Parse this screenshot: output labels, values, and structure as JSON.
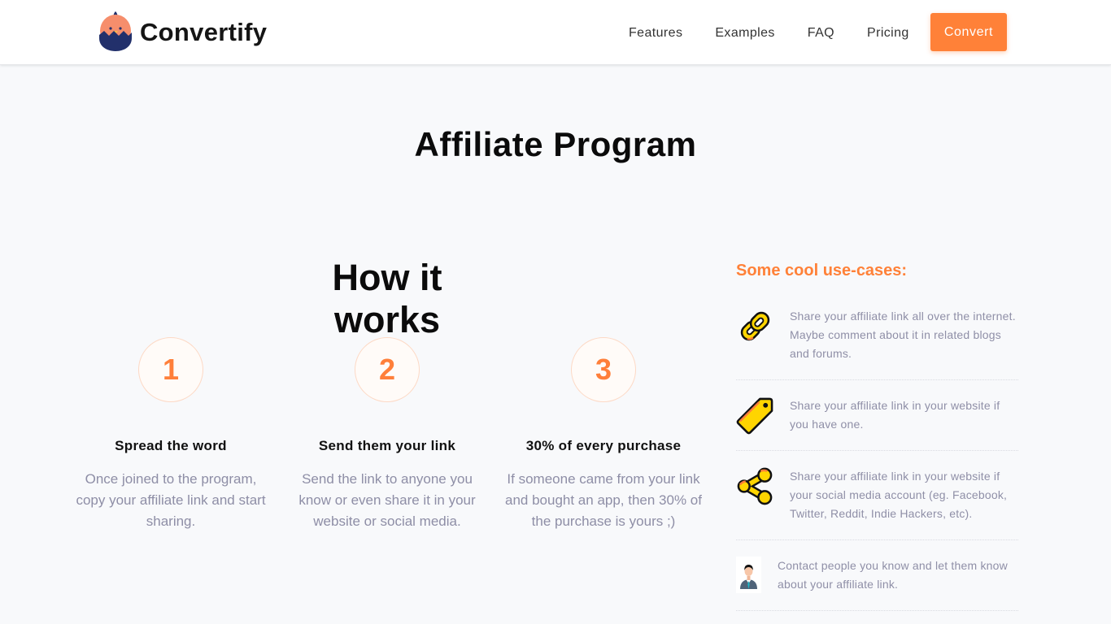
{
  "header": {
    "brand": "Convertify",
    "nav": [
      "Features",
      "Examples",
      "FAQ",
      "Pricing"
    ],
    "cta_label": "Convert"
  },
  "page": {
    "title": "Affiliate Program"
  },
  "how_it_works": {
    "title": "How it works",
    "steps": [
      {
        "number": "1",
        "title": "Spread the word",
        "description": "Once joined to the program, copy your affiliate link and start sharing."
      },
      {
        "number": "2",
        "title": "Send them your link",
        "description": "Send the link to anyone you know or even share it in your website or social media."
      },
      {
        "number": "3",
        "title": "30% of every purchase",
        "description": "If someone came from your link and bought an app, then 30% of the purchase is yours ;)"
      }
    ]
  },
  "use_cases": {
    "title": "Some cool use-cases:",
    "items": [
      {
        "icon": "chain-link-icon",
        "text": "Share your affiliate link all over the internet. Maybe comment about it in related blogs and forums."
      },
      {
        "icon": "price-tag-icon",
        "text": "Share your affiliate link in your website if you have one."
      },
      {
        "icon": "share-icon",
        "text": "Share your affiliate link in your website if your social media account (eg. Facebook, Twitter, Reddit, Indie Hackers, etc)."
      },
      {
        "icon": "businessman-icon",
        "text": "Contact people you know and let them know about your affiliate link."
      }
    ]
  },
  "colors": {
    "accent": "#ff8138",
    "logo_navy": "#22306b",
    "icon_yellow": "#ffd500",
    "muted_text": "#8f8fa7",
    "background": "#f8f9fb"
  }
}
